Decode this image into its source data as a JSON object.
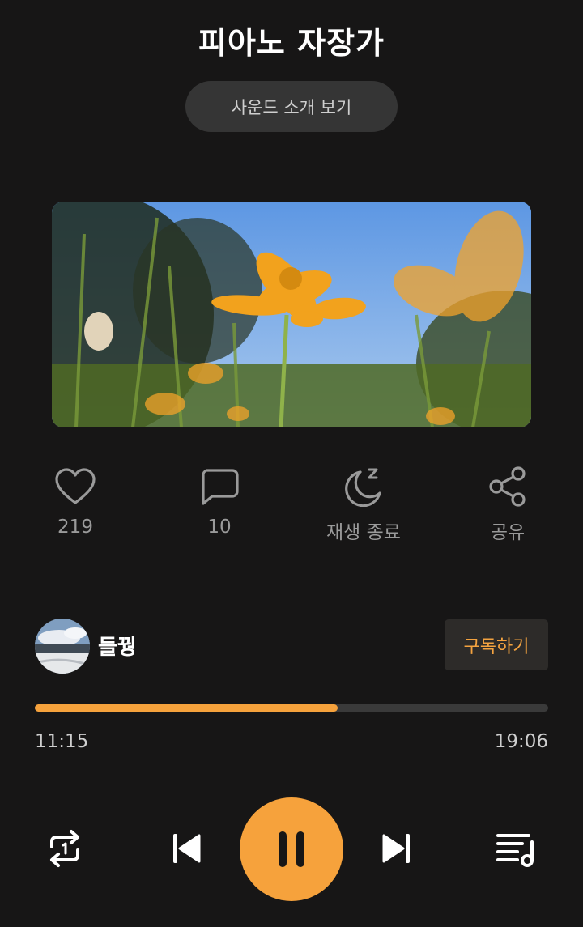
{
  "header": {
    "title": "피아노 자장가",
    "intro_button": "사운드 소개 보기"
  },
  "actions": {
    "like": {
      "count": "219",
      "icon": "heart-icon"
    },
    "comment": {
      "count": "10",
      "icon": "comment-icon"
    },
    "sleep_timer": {
      "label": "재생 종료",
      "icon": "moon-sleep-icon"
    },
    "share": {
      "label": "공유",
      "icon": "share-icon"
    }
  },
  "creator": {
    "name": "들꿩",
    "subscribe_label": "구독하기"
  },
  "player": {
    "elapsed": "11:15",
    "total": "19:06",
    "progress_fraction": 0.59,
    "accent_color": "#f6a23c",
    "controls": [
      "repeat-one-icon",
      "previous-icon",
      "pause-icon",
      "next-icon",
      "playlist-icon"
    ]
  }
}
